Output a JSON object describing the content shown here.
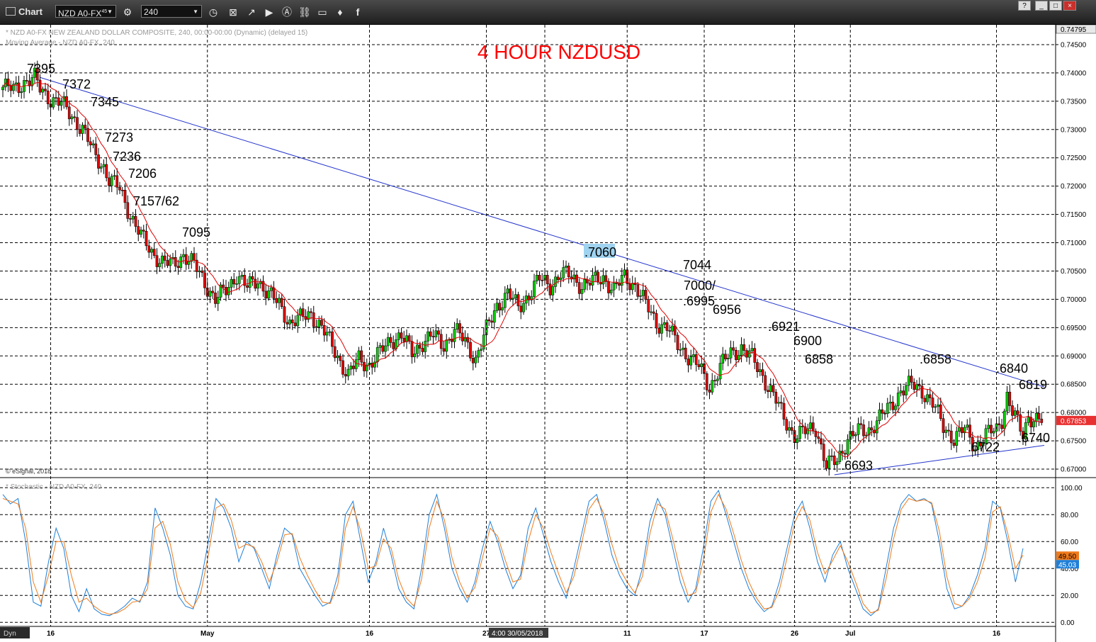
{
  "toolbar": {
    "title": "Chart",
    "symbol": "NZD A0-FX",
    "symbol_sup": "45",
    "interval": "240",
    "help": "?",
    "minimize": "_",
    "restore": "□",
    "close": "×"
  },
  "chart_data": [
    {
      "type": "candlestick",
      "header_line1": "* NZD A0-FX  NEW ZEALAND DOLLAR COMPOSITE, 240, 00:00-00:00 (Dynamic) (delayed 15)",
      "header_line2": "Moving Average - NZD A0-FX, 240",
      "title": "4 HOUR NZDUSD",
      "credit": "© eSignal, 2018",
      "ylim": [
        0.6685,
        0.7485
      ],
      "y_ticks": [
        "0.74500",
        "0.74000",
        "0.73500",
        "0.73000",
        "0.72500",
        "0.72000",
        "0.71500",
        "0.71000",
        "0.70500",
        "0.70000",
        "0.69500",
        "0.69000",
        "0.68500",
        "0.68000",
        "0.67500",
        "0.67000"
      ],
      "top_label": "0.74795",
      "last_price": "0.67853",
      "x_ticks": [
        "16",
        "May",
        "16",
        "27",
        "n",
        "11",
        "17",
        "26",
        "Jul",
        "16"
      ],
      "crosshair_time": "4:00 30/05/2018",
      "anchors": [
        [
          0,
          0.7375
        ],
        [
          4,
          0.737
        ],
        [
          8,
          0.7385
        ],
        [
          12,
          0.739
        ],
        [
          14,
          0.7372
        ],
        [
          18,
          0.7355
        ],
        [
          22,
          0.7345
        ],
        [
          26,
          0.7325
        ],
        [
          30,
          0.73
        ],
        [
          34,
          0.726
        ],
        [
          38,
          0.7235
        ],
        [
          40,
          0.721
        ],
        [
          44,
          0.7195
        ],
        [
          48,
          0.715
        ],
        [
          52,
          0.711
        ],
        [
          56,
          0.7085
        ],
        [
          60,
          0.7065
        ],
        [
          64,
          0.706
        ],
        [
          68,
          0.708
        ],
        [
          72,
          0.706
        ],
        [
          76,
          0.703
        ],
        [
          80,
          0.7
        ],
        [
          84,
          0.7015
        ],
        [
          88,
          0.7045
        ],
        [
          92,
          0.702
        ],
        [
          96,
          0.7035
        ],
        [
          100,
          0.701
        ],
        [
          104,
          0.699
        ],
        [
          108,
          0.696
        ],
        [
          112,
          0.6965
        ],
        [
          116,
          0.6975
        ],
        [
          120,
          0.695
        ],
        [
          126,
          0.69
        ],
        [
          130,
          0.6865
        ],
        [
          134,
          0.6895
        ],
        [
          138,
          0.6885
        ],
        [
          142,
          0.6905
        ],
        [
          146,
          0.693
        ],
        [
          150,
          0.6935
        ],
        [
          154,
          0.6905
        ],
        [
          158,
          0.6925
        ],
        [
          162,
          0.6935
        ],
        [
          166,
          0.692
        ],
        [
          170,
          0.6945
        ],
        [
          174,
          0.6925
        ],
        [
          178,
          0.6895
        ],
        [
          182,
          0.6945
        ],
        [
          186,
          0.699
        ],
        [
          190,
          0.701
        ],
        [
          194,
          0.6985
        ],
        [
          198,
          0.701
        ],
        [
          202,
          0.7035
        ],
        [
          206,
          0.7025
        ],
        [
          210,
          0.7045
        ],
        [
          214,
          0.704
        ],
        [
          218,
          0.7025
        ],
        [
          222,
          0.703
        ],
        [
          226,
          0.704
        ],
        [
          230,
          0.7015
        ],
        [
          234,
          0.704
        ],
        [
          238,
          0.7025
        ],
        [
          242,
          0.699
        ],
        [
          246,
          0.696
        ],
        [
          250,
          0.695
        ],
        [
          254,
          0.692
        ],
        [
          258,
          0.69
        ],
        [
          262,
          0.688
        ],
        [
          266,
          0.6845
        ],
        [
          270,
          0.688
        ],
        [
          274,
          0.6905
        ],
        [
          278,
          0.6915
        ],
        [
          282,
          0.6895
        ],
        [
          286,
          0.6865
        ],
        [
          290,
          0.683
        ],
        [
          294,
          0.679
        ],
        [
          298,
          0.676
        ],
        [
          302,
          0.6765
        ],
        [
          306,
          0.6775
        ],
        [
          310,
          0.6705
        ],
        [
          314,
          0.6715
        ],
        [
          318,
          0.6755
        ],
        [
          322,
          0.6765
        ],
        [
          326,
          0.677
        ],
        [
          330,
          0.679
        ],
        [
          334,
          0.681
        ],
        [
          338,
          0.684
        ],
        [
          342,
          0.6848
        ],
        [
          346,
          0.684
        ],
        [
          350,
          0.6815
        ],
        [
          354,
          0.6775
        ],
        [
          358,
          0.6755
        ],
        [
          362,
          0.677
        ],
        [
          366,
          0.674
        ],
        [
          370,
          0.676
        ],
        [
          374,
          0.677
        ],
        [
          376,
          0.679
        ],
        [
          378,
          0.683
        ],
        [
          380,
          0.68
        ],
        [
          384,
          0.676
        ],
        [
          386,
          0.6795
        ],
        [
          390,
          0.6785
        ]
      ],
      "annotations": [
        {
          "text": "7395"
        },
        {
          "text": "7372"
        },
        {
          "text": "7345"
        },
        {
          "text": "7273"
        },
        {
          "text": "7236"
        },
        {
          "text": "7206"
        },
        {
          "text": "7157/62"
        },
        {
          "text": "7095"
        },
        {
          "text": ".7060"
        },
        {
          "text": "7044"
        },
        {
          "text": "7000/"
        },
        {
          "text": ".6995"
        },
        {
          "text": "6956"
        },
        {
          "text": ".6921"
        },
        {
          "text": "6900"
        },
        {
          "text": "6858"
        },
        {
          "text": ".6693"
        },
        {
          "text": ".6858"
        },
        {
          "text": ".6722"
        },
        {
          "text": ".6840"
        },
        {
          "text": "6819"
        },
        {
          "text": ".6740"
        }
      ],
      "trendlines": [
        {
          "from": [
            14,
            0.7392
          ],
          "to": [
            392,
            0.6845
          ]
        },
        {
          "from": [
            313,
            0.669
          ],
          "to": [
            392,
            0.6742
          ]
        }
      ]
    },
    {
      "type": "line",
      "header": "* Stochastic - NZD A0-FX, 240",
      "ylim": [
        -3,
        107
      ],
      "y_ticks": [
        "100.00",
        "80.00",
        "60.00",
        "40.00",
        "20.00",
        "0.00"
      ],
      "last_values": [
        "49.50",
        "45.03"
      ],
      "corner_label": "Dyn",
      "series": [
        {
          "values": [
            95,
            88,
            92,
            60,
            15,
            12,
            45,
            70,
            55,
            20,
            8,
            25,
            10,
            6,
            5,
            8,
            12,
            18,
            15,
            30,
            85,
            70,
            50,
            20,
            12,
            10,
            30,
            60,
            92,
            85,
            70,
            45,
            60,
            55,
            40,
            25,
            50,
            70,
            65,
            40,
            30,
            20,
            12,
            15,
            35,
            80,
            90,
            60,
            30,
            45,
            70,
            50,
            25,
            15,
            10,
            40,
            80,
            95,
            70,
            40,
            25,
            15,
            30,
            55,
            75,
            60,
            40,
            25,
            35,
            70,
            85,
            65,
            45,
            30,
            18,
            40,
            65,
            90,
            95,
            75,
            50,
            35,
            25,
            20,
            40,
            75,
            92,
            80,
            55,
            30,
            15,
            25,
            55,
            90,
            98,
            80,
            60,
            40,
            25,
            15,
            8,
            12,
            30,
            55,
            80,
            90,
            70,
            45,
            30,
            50,
            60,
            40,
            25,
            10,
            5,
            10,
            40,
            70,
            88,
            95,
            90,
            92,
            88,
            60,
            25,
            10,
            12,
            20,
            35,
            55,
            90,
            85,
            60,
            30,
            55
          ]
        },
        {
          "values": [
            92,
            90,
            88,
            70,
            30,
            15,
            35,
            60,
            60,
            35,
            15,
            18,
            12,
            8,
            6,
            7,
            10,
            15,
            16,
            25,
            70,
            75,
            58,
            30,
            16,
            11,
            22,
            50,
            85,
            88,
            76,
            55,
            58,
            56,
            45,
            30,
            45,
            65,
            66,
            48,
            35,
            24,
            15,
            14,
            28,
            70,
            86,
            68,
            40,
            42,
            62,
            55,
            32,
            18,
            12,
            32,
            70,
            90,
            76,
            48,
            30,
            18,
            26,
            48,
            70,
            64,
            46,
            30,
            32,
            60,
            80,
            70,
            52,
            36,
            22,
            34,
            58,
            84,
            92,
            80,
            58,
            40,
            30,
            22,
            34,
            66,
            88,
            84,
            62,
            38,
            20,
            22,
            46,
            82,
            95,
            84,
            66,
            46,
            30,
            18,
            10,
            11,
            24,
            48,
            74,
            86,
            76,
            52,
            36,
            46,
            57,
            45,
            30,
            14,
            7,
            9,
            32,
            62,
            84,
            92,
            90,
            91,
            89,
            68,
            34,
            14,
            12,
            18,
            30,
            48,
            82,
            86,
            66,
            40,
            50
          ]
        }
      ]
    }
  ]
}
